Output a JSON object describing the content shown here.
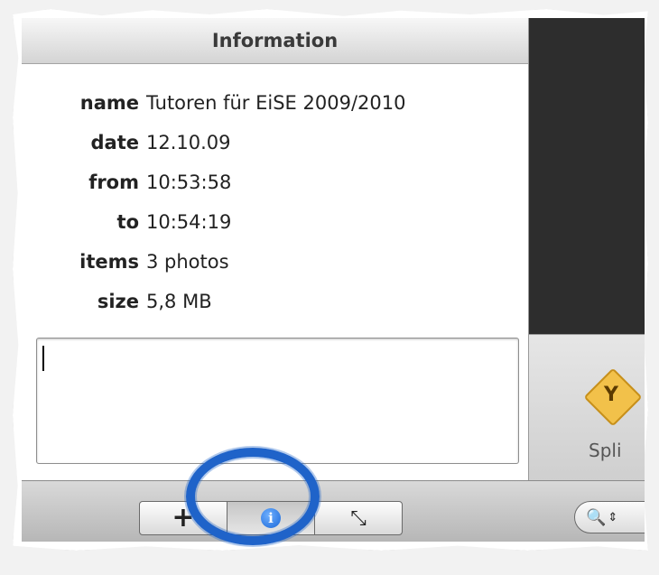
{
  "info_panel": {
    "title": "Information",
    "rows": [
      {
        "key": "name",
        "value": "Tutoren für EiSE 2009/2010"
      },
      {
        "key": "date",
        "value": "12.10.09"
      },
      {
        "key": "from",
        "value": "10:53:58"
      },
      {
        "key": "to",
        "value": "10:54:19"
      },
      {
        "key": "items",
        "value": "3 photos"
      },
      {
        "key": "size",
        "value": "5,8 MB"
      }
    ],
    "comment_value": ""
  },
  "right_tools": {
    "split_label": "Spli"
  },
  "bottom_bar": {
    "add_glyph": "+",
    "info_glyph": "i",
    "expand_glyph": "⤡",
    "search_glyph": "🔍",
    "search_arrows": "⇕"
  },
  "colors": {
    "highlight_ring": "#1f63c9",
    "info_icon": "#1a67d8"
  }
}
